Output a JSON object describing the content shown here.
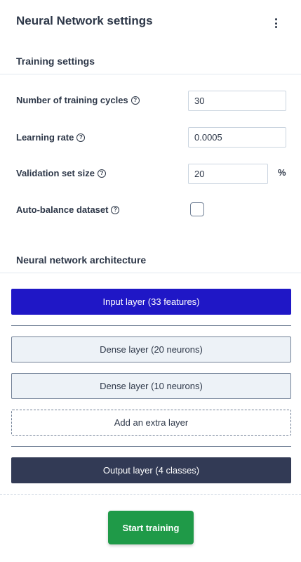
{
  "header": {
    "title": "Neural Network settings",
    "menu_icon": "kebab-menu-icon"
  },
  "training": {
    "section_title": "Training settings",
    "cycles": {
      "label": "Number of training cycles",
      "value": "30"
    },
    "learning_rate": {
      "label": "Learning rate",
      "value": "0.0005"
    },
    "validation": {
      "label": "Validation set size",
      "value": "20",
      "unit": "%"
    },
    "auto_balance": {
      "label": "Auto-balance dataset",
      "checked": false
    },
    "help_icon_glyph": "?"
  },
  "architecture": {
    "section_title": "Neural network architecture",
    "input_layer": "Input layer (33 features)",
    "dense_layers": [
      "Dense layer (20 neurons)",
      "Dense layer (10 neurons)"
    ],
    "add_layer": "Add an extra layer",
    "output_layer": "Output layer (4 classes)"
  },
  "actions": {
    "start_training": "Start training"
  },
  "colors": {
    "input_layer_bg": "#1f17c6",
    "output_layer_bg": "#323a55",
    "start_button_bg": "#1f9a48"
  }
}
